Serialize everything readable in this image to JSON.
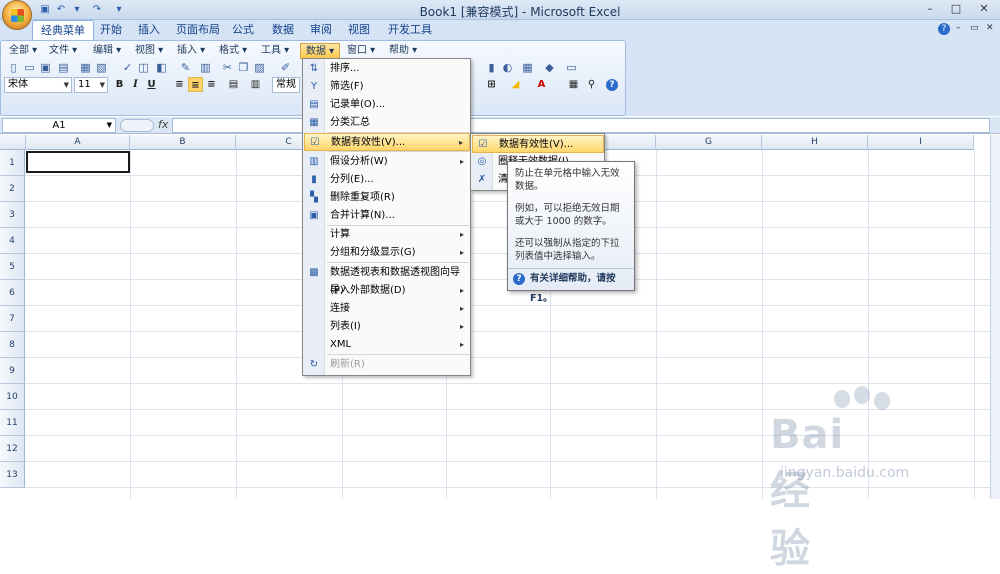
{
  "window": {
    "title": "Book1  [兼容模式] - Microsoft Excel",
    "min": "–",
    "max": "□",
    "close": "✕"
  },
  "tabs": [
    "经典菜单",
    "开始",
    "插入",
    "页面布局",
    "公式",
    "数据",
    "审阅",
    "视图",
    "开发工具"
  ],
  "menubar": [
    {
      "label": "全部 ▾"
    },
    {
      "label": "文件 ▾"
    },
    {
      "label": "编辑 ▾"
    },
    {
      "label": "视图 ▾"
    },
    {
      "label": "插入 ▾"
    },
    {
      "label": "格式 ▾"
    },
    {
      "label": "工具 ▾"
    },
    {
      "label": "数据 ▾"
    },
    {
      "label": "窗口 ▾"
    },
    {
      "label": "帮助 ▾"
    }
  ],
  "font": {
    "name": "宋体",
    "size": "11",
    "style": "常规"
  },
  "formula": {
    "namebox": "A1",
    "fx": "fx"
  },
  "columns": [
    "A",
    "B",
    "C",
    "D",
    "E",
    "F",
    "G",
    "H",
    "I"
  ],
  "rows": [
    "1",
    "2",
    "3",
    "4",
    "5",
    "6",
    "7",
    "8",
    "9",
    "10",
    "11",
    "12",
    "13"
  ],
  "data_menu": {
    "items": [
      {
        "label": "排序...",
        "icon": "sort-icon",
        "glyph": "⇅"
      },
      {
        "label": "筛选(F)",
        "icon": "filter-icon",
        "glyph": "Y"
      },
      {
        "label": "记录单(O)...",
        "icon": "form-icon",
        "glyph": "▤"
      },
      {
        "label": "分类汇总",
        "icon": "subtotal-icon",
        "glyph": "▦"
      },
      {
        "label": "数据有效性(V)...",
        "icon": "validation-icon",
        "glyph": "☑",
        "submenu": true
      },
      {
        "label": "假设分析(W)",
        "icon": "whatif-icon",
        "glyph": "▥",
        "submenu": true
      },
      {
        "label": "分列(E)...",
        "icon": "text-to-columns-icon",
        "glyph": "▮"
      },
      {
        "label": "删除重复项(R)",
        "icon": "remove-duplicates-icon",
        "glyph": "▚"
      },
      {
        "label": "合并计算(N)...",
        "icon": "consolidate-icon",
        "glyph": "▣"
      },
      {
        "label": "计算",
        "submenu": true
      },
      {
        "label": "分组和分级显示(G)",
        "submenu": true
      },
      {
        "label": "数据透视表和数据透视图向导(P)",
        "icon": "pivot-icon",
        "glyph": "▩"
      },
      {
        "label": "导入外部数据(D)",
        "submenu": true
      },
      {
        "label": "连接",
        "submenu": true
      },
      {
        "label": "列表(I)",
        "submenu": true
      },
      {
        "label": "XML",
        "submenu": true
      },
      {
        "label": "刷新(R)",
        "icon": "refresh-icon",
        "glyph": "↻",
        "disabled": true
      }
    ]
  },
  "sub_menu": {
    "items": [
      {
        "label": "数据有效性(V)...",
        "icon": "validation-icon",
        "glyph": "☑"
      },
      {
        "label": "圈释无效数据(I)",
        "icon": "circle-invalid-icon",
        "glyph": "◎"
      },
      {
        "label": "清除无效数据标识圈(R)",
        "icon": "clear-circles-icon",
        "glyph": "✗"
      }
    ]
  },
  "tooltip": {
    "p1": "防止在单元格中输入无效数据。",
    "p2": "例如，可以拒绝无效日期或大于 1000 的数字。",
    "p3": "还可以强制从指定的下拉列表值中选择输入。",
    "help": "有关详细帮助，请按 F1。"
  },
  "watermark": {
    "text": "Bai 经验",
    "url": "jingyan.baidu.com"
  }
}
